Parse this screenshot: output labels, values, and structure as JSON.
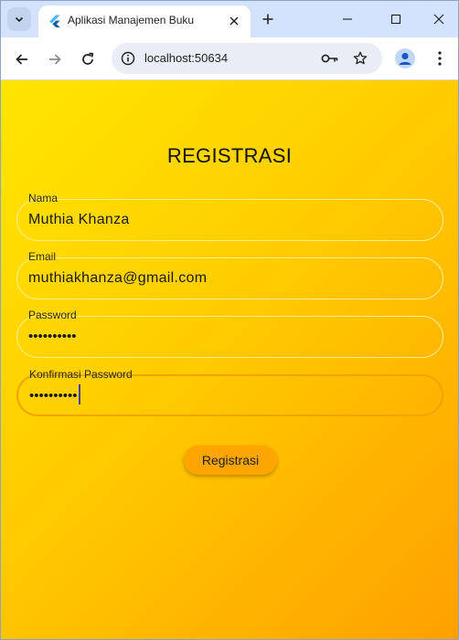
{
  "browser": {
    "tab_title": "Aplikasi Manajemen Buku",
    "url": "localhost:50634"
  },
  "icons": {
    "tab_search": "chevron-down-icon",
    "favicon": "flutter-icon",
    "tab_close": "close-icon",
    "new_tab": "plus-icon",
    "minimize": "minimize-icon",
    "maximize": "maximize-icon",
    "close_window": "close-window-icon",
    "back": "arrow-left-icon",
    "forward": "arrow-right-icon",
    "reload": "reload-icon",
    "site_info": "info-icon",
    "passwords": "key-icon",
    "bookmark": "star-icon",
    "profile": "person-icon",
    "menu": "kebab-menu-icon"
  },
  "colors": {
    "gradient_start": "#ffe600",
    "gradient_end": "#ffa000",
    "button": "#ffa500",
    "tabstrip": "#d3e3fd"
  },
  "page": {
    "title": "REGISTRASI",
    "fields": [
      {
        "label": "Nama",
        "value": "Muthia Khanza"
      },
      {
        "label": "Email",
        "value": "muthiakhanza@gmail.com"
      },
      {
        "label": "Password",
        "value": "••••••••••"
      },
      {
        "label": "Konfirmasi Password",
        "value": "••••••••••"
      }
    ],
    "submit_label": "Registrasi"
  }
}
